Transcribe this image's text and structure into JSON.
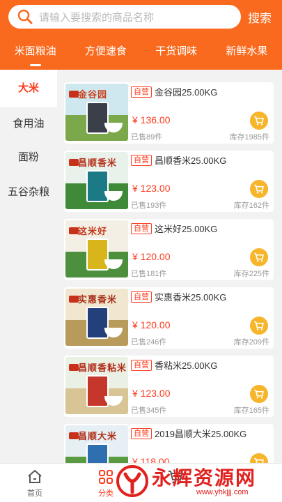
{
  "search": {
    "placeholder": "请输入要搜索的商品名称",
    "button_label": "搜索"
  },
  "category_tabs": [
    {
      "label": "米面粮油",
      "active": true
    },
    {
      "label": "方便速食",
      "active": false
    },
    {
      "label": "干货调味",
      "active": false
    },
    {
      "label": "新鲜水果",
      "active": false
    }
  ],
  "sidebar": {
    "items": [
      {
        "label": "大米",
        "active": true
      },
      {
        "label": "食用油",
        "active": false
      },
      {
        "label": "面粉",
        "active": false
      },
      {
        "label": "五谷杂粮",
        "active": false
      }
    ]
  },
  "products": [
    {
      "badge": "自营",
      "name": "金谷园25.00KG",
      "price": "¥ 136.00",
      "sold": "已售89件",
      "stock": "库存1985件",
      "image_brand": "金谷园",
      "sky": "#cfe8ef",
      "ground": "#7aa84a",
      "bag": "#3a3f4a",
      "brand_color": "#c8441d"
    },
    {
      "badge": "自营",
      "name": "昌顺香米25.00KG",
      "price": "¥ 123.00",
      "sold": "已售193件",
      "stock": "库存162件",
      "image_brand": "昌顺香米",
      "sky": "#e9f2ea",
      "ground": "#3f8a38",
      "bag": "#1c7a86",
      "brand_color": "#b5311c"
    },
    {
      "badge": "自营",
      "name": "这米好25.00KG",
      "price": "¥ 120.00",
      "sold": "已售181件",
      "stock": "库存225件",
      "image_brand": "这米好",
      "sky": "#f4efe4",
      "ground": "#4c8f3d",
      "bag": "#d9b51c",
      "brand_color": "#c13a1b"
    },
    {
      "badge": "自营",
      "name": "实惠香米25.00KG",
      "price": "¥ 120.00",
      "sold": "已售246件",
      "stock": "库存209件",
      "image_brand": "实惠香米",
      "sky": "#f1e6cf",
      "ground": "#b89a5a",
      "bag": "#23407a",
      "brand_color": "#a8301a"
    },
    {
      "badge": "自营",
      "name": "香粘米25.00KG",
      "price": "¥ 123.00",
      "sold": "已售345件",
      "stock": "库存165件",
      "image_brand": "昌顺香粘米",
      "sky": "#eaf1e4",
      "ground": "#d9c495",
      "bag": "#c5372a",
      "brand_color": "#b22b1a"
    },
    {
      "badge": "自营",
      "name": "2019昌顺大米25.00KG",
      "price": "¥ 118.00",
      "sold": "",
      "stock": "",
      "image_brand": "昌顺大米",
      "sky": "#e6f0f4",
      "ground": "#5a9a42",
      "bag": "#2f6fb0",
      "brand_color": "#b12f1c"
    }
  ],
  "tabbar": {
    "home_label": "首页",
    "category_label": "分类",
    "cart_label": ""
  },
  "watermark": {
    "text": "永辉资源网",
    "url": "www.yhkjjj.com"
  },
  "colors": {
    "accent": "#fa6a1e",
    "price": "#fa3c1e",
    "cart_button": "#f6b52a"
  }
}
